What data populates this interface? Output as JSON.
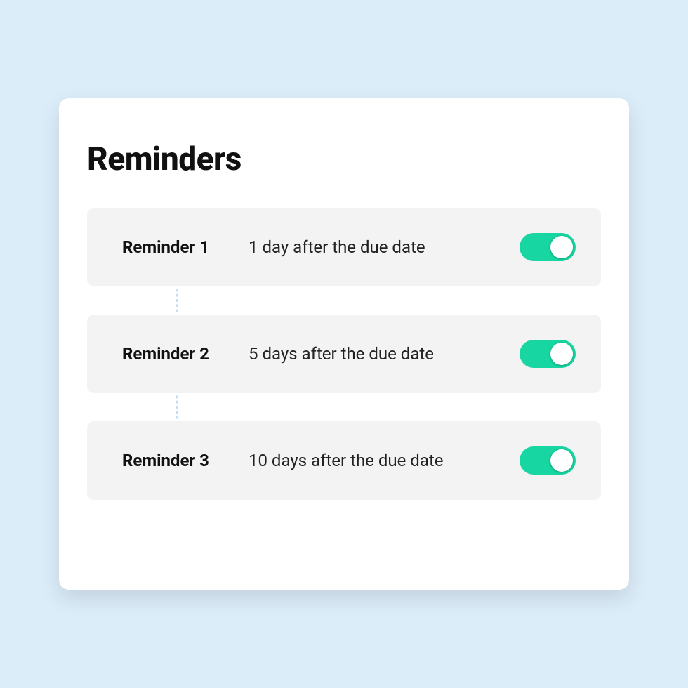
{
  "title": "Reminders",
  "colors": {
    "toggle_on": "#17d6a1"
  },
  "reminders": [
    {
      "label": "Reminder 1",
      "description": "1 day after the due date",
      "enabled": true
    },
    {
      "label": "Reminder 2",
      "description": "5 days after the due date",
      "enabled": true
    },
    {
      "label": "Reminder 3",
      "description": "10 days after the due date",
      "enabled": true
    }
  ]
}
